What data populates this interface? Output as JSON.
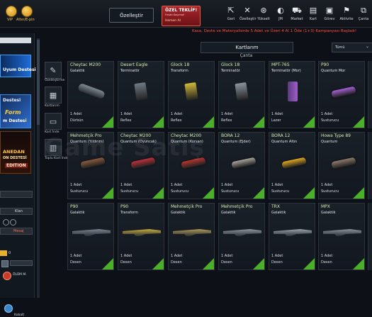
{
  "topbar": {
    "vip_label": "VIP",
    "altin_label": "Altın/E-pin",
    "customize_label": "Özelleştir",
    "offer": {
      "title": "ÖZEL TEKLİF!",
      "desc": "Fırsatı Kaçırma!",
      "action": "Hemen Al"
    },
    "nav": [
      {
        "label": "Geri",
        "icon": "back-icon"
      },
      {
        "label": "Özelleştir",
        "icon": "customize-icon"
      },
      {
        "label": "Yükselt",
        "icon": "upgrade-icon"
      },
      {
        "label": "JM",
        "icon": "jm-icon"
      },
      {
        "label": "Market",
        "icon": "cart-icon"
      },
      {
        "label": "Kart",
        "icon": "card-icon"
      },
      {
        "label": "Görev",
        "icon": "mission-icon"
      },
      {
        "label": "Aktivite",
        "icon": "activity-icon"
      },
      {
        "label": "Çanta",
        "icon": "bag-icon"
      }
    ]
  },
  "promo_text": "Kasa, Deste ve Materyallerde 5 Adet ve Üzeri 4 Al 1 Öde (1+3) Kampanyası Başladı!",
  "left_panel": {
    "deck1": "Uyum Destesi",
    "deck2a": "Destesi",
    "deck2b": "Form",
    "deck2c": "m Destesi",
    "deck3a": "ANEDAN",
    "deck3b": "ON DESTESİ",
    "deck3c": "EDITION",
    "clan": "Klan",
    "mesaj": "Mesaj",
    "olum": "ÖLÜM M.",
    "kobalt": "Kobalt",
    "gold": "0"
  },
  "side_tabs": [
    {
      "label": "Özelleştirme"
    },
    {
      "label": "Kartlarım"
    },
    {
      "label": "Kart İnde"
    },
    {
      "label": "Toplu Kart İnde"
    }
  ],
  "panel": {
    "title": "Kartlarım",
    "subtitle": "Çanta"
  },
  "filter": {
    "value": "Tümü"
  },
  "watermark": "Game Satış",
  "cards": [
    {
      "name": "Cheytac M200",
      "category": "Galaktik",
      "count": "1 Adet",
      "attachment": "Dürbün",
      "item": "scope",
      "color": "#7f8a93"
    },
    {
      "name": "Desert Eagle",
      "category": "Terminatör",
      "count": "1 Adet",
      "attachment": "Reflex",
      "item": "reflex",
      "color": "#6f7a84"
    },
    {
      "name": "Glock 18",
      "category": "Transform",
      "count": "1 Adet",
      "attachment": "Reflex",
      "item": "reflex",
      "color": "#d2b83a"
    },
    {
      "name": "Glock 18",
      "category": "Terminatör",
      "count": "1 Adet",
      "attachment": "Reflex",
      "item": "reflex",
      "color": "#8a949d"
    },
    {
      "name": "MPT-76S",
      "category": "Terminatör (Mor)",
      "count": "1 Adet",
      "attachment": "Lazer",
      "item": "laser",
      "color": "#a05fcf"
    },
    {
      "name": "P90",
      "category": "Quantum Mor",
      "count": "1 Adet",
      "attachment": "Susturucu",
      "item": "suppressor",
      "color": "#a85fd6"
    },
    {
      "name": "Mehmetçik Pro",
      "category": "Quantum (Yıldırım)",
      "count": "1 Adet",
      "attachment": "Susturucu",
      "item": "suppressor",
      "color": "#8a5a3c"
    },
    {
      "name": "Cheytac M200",
      "category": "Quantum (Oyuncak)",
      "count": "1 Adet",
      "attachment": "Susturucu",
      "item": "suppressor",
      "color": "#c0303a"
    },
    {
      "name": "Cheytac M200",
      "category": "Quantum (Korsan)",
      "count": "1 Adet",
      "attachment": "Susturucu",
      "item": "suppressor",
      "color": "#b8342c"
    },
    {
      "name": "BORA 12",
      "category": "Quantum (Ejder)",
      "count": "1 Adet",
      "attachment": "Susturucu",
      "item": "suppressor",
      "color": "#a8a39b"
    },
    {
      "name": "BORA 12",
      "category": "Quantum Altın",
      "count": "1 Adet",
      "attachment": "Susturucu",
      "item": "suppressor",
      "color": "#e0a81e"
    },
    {
      "name": "Howa Type 89",
      "category": "Quantum",
      "count": "1 Adet",
      "attachment": "Susturucu",
      "item": "suppressor",
      "color": "#8e7a6c"
    },
    {
      "name": "P90",
      "category": "Galaktik",
      "count": "1 Adet",
      "attachment": "Desen",
      "item": "rifle",
      "color": "#7a8590"
    },
    {
      "name": "P90",
      "category": "Transform",
      "count": "1 Adet",
      "attachment": "Desen",
      "item": "rifle",
      "color": "#c9ad3a"
    },
    {
      "name": "Mehmetçik Pro",
      "category": "Galaktik",
      "count": "1 Adet",
      "attachment": "Desen",
      "item": "rifle",
      "color": "#b09a58"
    },
    {
      "name": "Mehmetçik Pro",
      "category": "Galaktik",
      "count": "1 Adet",
      "attachment": "Desen",
      "item": "rifle",
      "color": "#8c96a0"
    },
    {
      "name": "TRX",
      "category": "Galaktik",
      "count": "1 Adet",
      "attachment": "Desen",
      "item": "rifle",
      "color": "#9aa3ab"
    },
    {
      "name": "MPX",
      "category": "Galaktik",
      "count": "1 Adet",
      "attachment": "Desen",
      "item": "rifle",
      "color": "#8a939b"
    }
  ]
}
